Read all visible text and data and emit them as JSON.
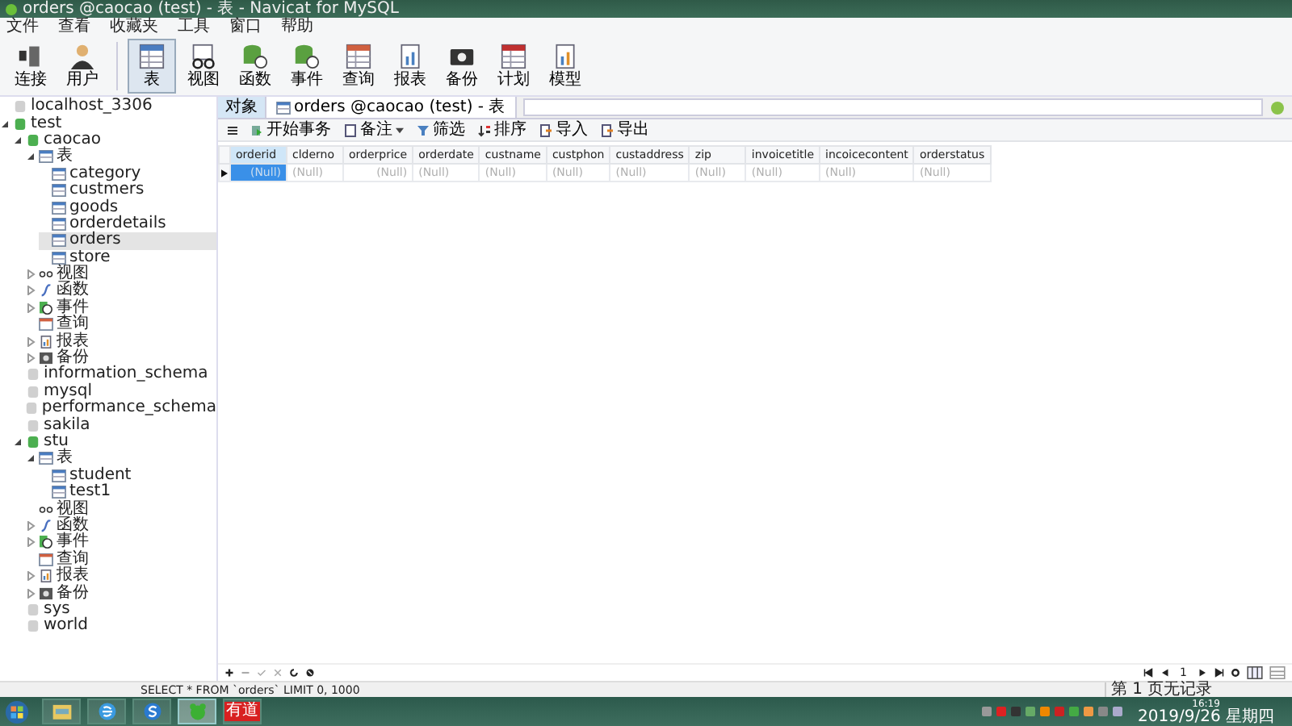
{
  "window": {
    "title": "orders @caocao (test) - 表 - Navicat for MySQL"
  },
  "menu": [
    "文件",
    "查看",
    "收藏夹",
    "工具",
    "窗口",
    "帮助"
  ],
  "toolbar": [
    {
      "label": "连接",
      "kind": "connect",
      "selected": false
    },
    {
      "label": "用户",
      "kind": "user",
      "selected": false
    },
    {
      "label": "表",
      "kind": "table",
      "selected": true
    },
    {
      "label": "视图",
      "kind": "view",
      "selected": false
    },
    {
      "label": "函数",
      "kind": "function",
      "selected": false
    },
    {
      "label": "事件",
      "kind": "event",
      "selected": false
    },
    {
      "label": "查询",
      "kind": "query",
      "selected": false
    },
    {
      "label": "报表",
      "kind": "report",
      "selected": false
    },
    {
      "label": "备份",
      "kind": "backup",
      "selected": false
    },
    {
      "label": "计划",
      "kind": "schedule",
      "selected": false
    },
    {
      "label": "模型",
      "kind": "model",
      "selected": false
    }
  ],
  "tree": [
    {
      "label": "localhost_3306",
      "kind": "server-off"
    },
    {
      "label": "test",
      "kind": "server",
      "expanded": true,
      "children": [
        {
          "label": "caocao",
          "kind": "database",
          "expanded": true,
          "children": [
            {
              "label": "表",
              "kind": "table",
              "expanded": true,
              "children": [
                {
                  "label": "category",
                  "kind": "tableitem",
                  "selected": false
                },
                {
                  "label": "custmers",
                  "kind": "tableitem",
                  "selected": false
                },
                {
                  "label": "goods",
                  "kind": "tableitem",
                  "selected": false
                },
                {
                  "label": "orderdetails",
                  "kind": "tableitem",
                  "selected": false
                },
                {
                  "label": "orders",
                  "kind": "tableitem",
                  "selected": true
                },
                {
                  "label": "store",
                  "kind": "tableitem",
                  "selected": false
                }
              ]
            },
            {
              "label": "视图",
              "kind": "view",
              "expanded": false
            },
            {
              "label": "函数",
              "kind": "function",
              "expanded": false
            },
            {
              "label": "事件",
              "kind": "event",
              "expanded": false
            },
            {
              "label": "查询",
              "kind": "query"
            },
            {
              "label": "报表",
              "kind": "report",
              "expanded": false
            },
            {
              "label": "备份",
              "kind": "backup",
              "expanded": false
            }
          ]
        },
        {
          "label": "information_schema",
          "kind": "database-off"
        },
        {
          "label": "mysql",
          "kind": "database-off"
        },
        {
          "label": "performance_schema",
          "kind": "database-off"
        },
        {
          "label": "sakila",
          "kind": "database-off"
        },
        {
          "label": "stu",
          "kind": "database",
          "expanded": true,
          "children": [
            {
              "label": "表",
              "kind": "table",
              "expanded": true,
              "children": [
                {
                  "label": "student",
                  "kind": "tableitem",
                  "selected": false
                },
                {
                  "label": "test1",
                  "kind": "tableitem",
                  "selected": false
                }
              ]
            },
            {
              "label": "视图",
              "kind": "view"
            },
            {
              "label": "函数",
              "kind": "function",
              "expanded": false
            },
            {
              "label": "事件",
              "kind": "event",
              "expanded": false
            },
            {
              "label": "查询",
              "kind": "query"
            },
            {
              "label": "报表",
              "kind": "report",
              "expanded": false
            },
            {
              "label": "备份",
              "kind": "backup",
              "expanded": false
            }
          ]
        },
        {
          "label": "sys",
          "kind": "database-off"
        },
        {
          "label": "world",
          "kind": "database-off"
        }
      ]
    }
  ],
  "tabs": [
    {
      "label": "对象",
      "kind": "plain",
      "selected": false
    },
    {
      "label": "orders @caocao (test) - 表",
      "kind": "table",
      "selected": true
    }
  ],
  "table_toolbar": [
    {
      "label": "开始事务",
      "kind": "transaction"
    },
    {
      "label": "备注",
      "kind": "note",
      "dropdown": true
    },
    {
      "label": "筛选",
      "kind": "filter"
    },
    {
      "label": "排序",
      "kind": "sort"
    },
    {
      "label": "导入",
      "kind": "import"
    },
    {
      "label": "导出",
      "kind": "export"
    }
  ],
  "table": {
    "columns": [
      {
        "name": "orderid",
        "kind": "number",
        "selected": true
      },
      {
        "name": "clderno",
        "kind": "text",
        "selected": false
      },
      {
        "name": "orderprice",
        "kind": "number",
        "selected": false
      },
      {
        "name": "orderdate",
        "kind": "text",
        "selected": false
      },
      {
        "name": "custname",
        "kind": "text",
        "selected": false
      },
      {
        "name": "custphon",
        "kind": "text",
        "selected": false
      },
      {
        "name": "custaddress",
        "kind": "text",
        "selected": false
      },
      {
        "name": "zip",
        "kind": "text",
        "selected": false
      },
      {
        "name": "invoicetitle",
        "kind": "text",
        "selected": false
      },
      {
        "name": "incoicecontent",
        "kind": "text",
        "selected": false
      },
      {
        "name": "orderstatus",
        "kind": "text",
        "selected": false
      }
    ],
    "rows": [
      {
        "current": true,
        "cells": [
          "(Null)",
          "(Null)",
          "(Null)",
          "(Null)",
          "(Null)",
          "(Null)",
          "(Null)",
          "(Null)",
          "(Null)",
          "(Null)",
          "(Null)"
        ]
      }
    ]
  },
  "pager": {
    "page": "1"
  },
  "status_bar": {
    "sql": "SELECT * FROM `orders` LIMIT 0, 1000",
    "records": "第 1 页无记录"
  },
  "taskbar": {
    "apps": [
      {
        "kind": "folder"
      },
      {
        "kind": "browser"
      },
      {
        "kind": "sogou"
      },
      {
        "kind": "navicat",
        "selected": true
      },
      {
        "kind": "youdao",
        "label": "有道"
      }
    ],
    "time": "16:19",
    "date": "2019/9/26 星期四"
  }
}
